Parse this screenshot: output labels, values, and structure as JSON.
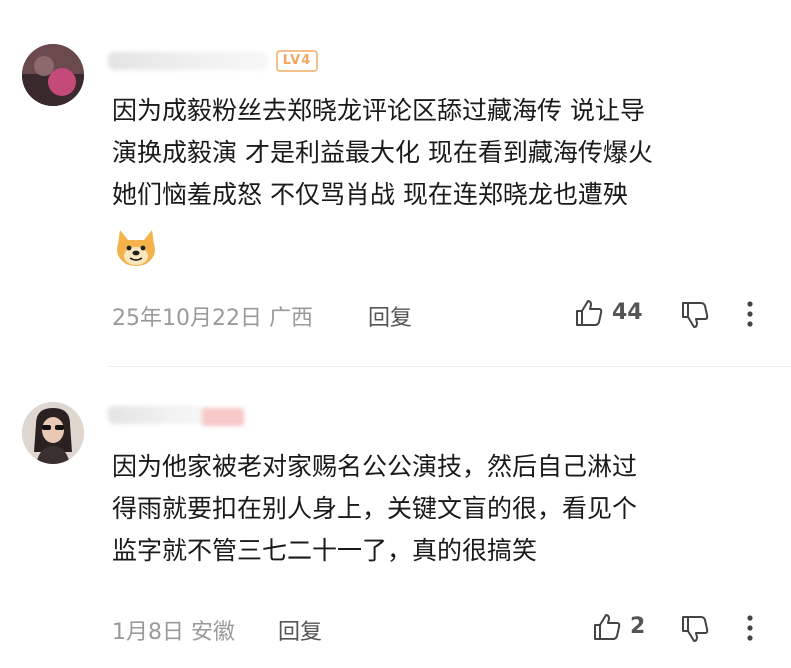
{
  "comments": [
    {
      "level_badge": "LV4",
      "text_lines": [
        "因为成毅粉丝去郑晓龙评论区舔过藏海传 说让导",
        "演换成毅演 才是利益最大化 现在看到藏海传爆火",
        "她们恼羞成怒 不仅骂肖战 现在连郑晓龙也遭殃"
      ],
      "emoji": "doge-emoji",
      "date_location": "25年10月22日 广西",
      "reply_label": "回复",
      "like_count": "44"
    },
    {
      "text_lines": [
        "因为他家被老对家赐名公公演技，然后自己淋过",
        "得雨就要扣在别人身上，关键文盲的很，看见个",
        "监字就不管三七二十一了，真的很搞笑"
      ],
      "date_location": "1月8日 安徽",
      "reply_label": "回复",
      "like_count": "2"
    }
  ],
  "colors": {
    "text": "#1a1a1a",
    "meta": "#9a9a9a",
    "level_badge": "#f0a860"
  },
  "icons": [
    "like-icon",
    "dislike-icon",
    "more-icon"
  ]
}
